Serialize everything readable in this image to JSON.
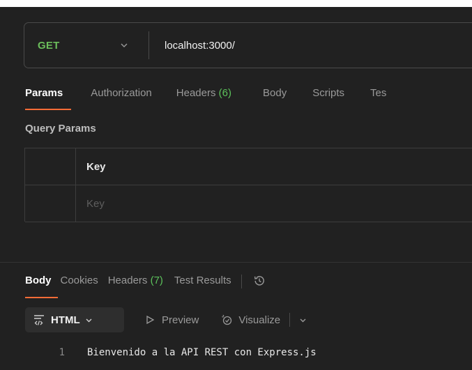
{
  "request": {
    "method": "GET",
    "url": "localhost:3000/"
  },
  "request_tabs": [
    {
      "label": "Params",
      "count": "",
      "active": true
    },
    {
      "label": "Authorization",
      "count": "",
      "active": false
    },
    {
      "label": "Headers",
      "count": "(6)",
      "active": false
    },
    {
      "label": "Body",
      "count": "",
      "active": false
    },
    {
      "label": "Scripts",
      "count": "",
      "active": false
    },
    {
      "label": "Tes",
      "count": "",
      "active": false
    }
  ],
  "query_params": {
    "title": "Query Params",
    "header_key": "Key",
    "key_placeholder": "Key"
  },
  "response_tabs": [
    {
      "label": "Body",
      "count": "",
      "active": true
    },
    {
      "label": "Cookies",
      "count": "",
      "active": false
    },
    {
      "label": "Headers",
      "count": "(7)",
      "active": false
    },
    {
      "label": "Test Results",
      "count": "",
      "active": false
    }
  ],
  "response_toolbar": {
    "format_label": "HTML",
    "preview_label": "Preview",
    "visualize_label": "Visualize"
  },
  "response_body": {
    "line_number": "1",
    "line_text": "Bienvenido a la API REST con Express.js"
  },
  "colors": {
    "background": "#212121",
    "method_green": "#6bbd5b",
    "count_green": "#5cc15b",
    "active_underline": "#ff6c37"
  },
  "icons": [
    "chevron-down-icon",
    "history-icon",
    "html-format-icon",
    "play-outline-icon",
    "visualize-icon"
  ]
}
